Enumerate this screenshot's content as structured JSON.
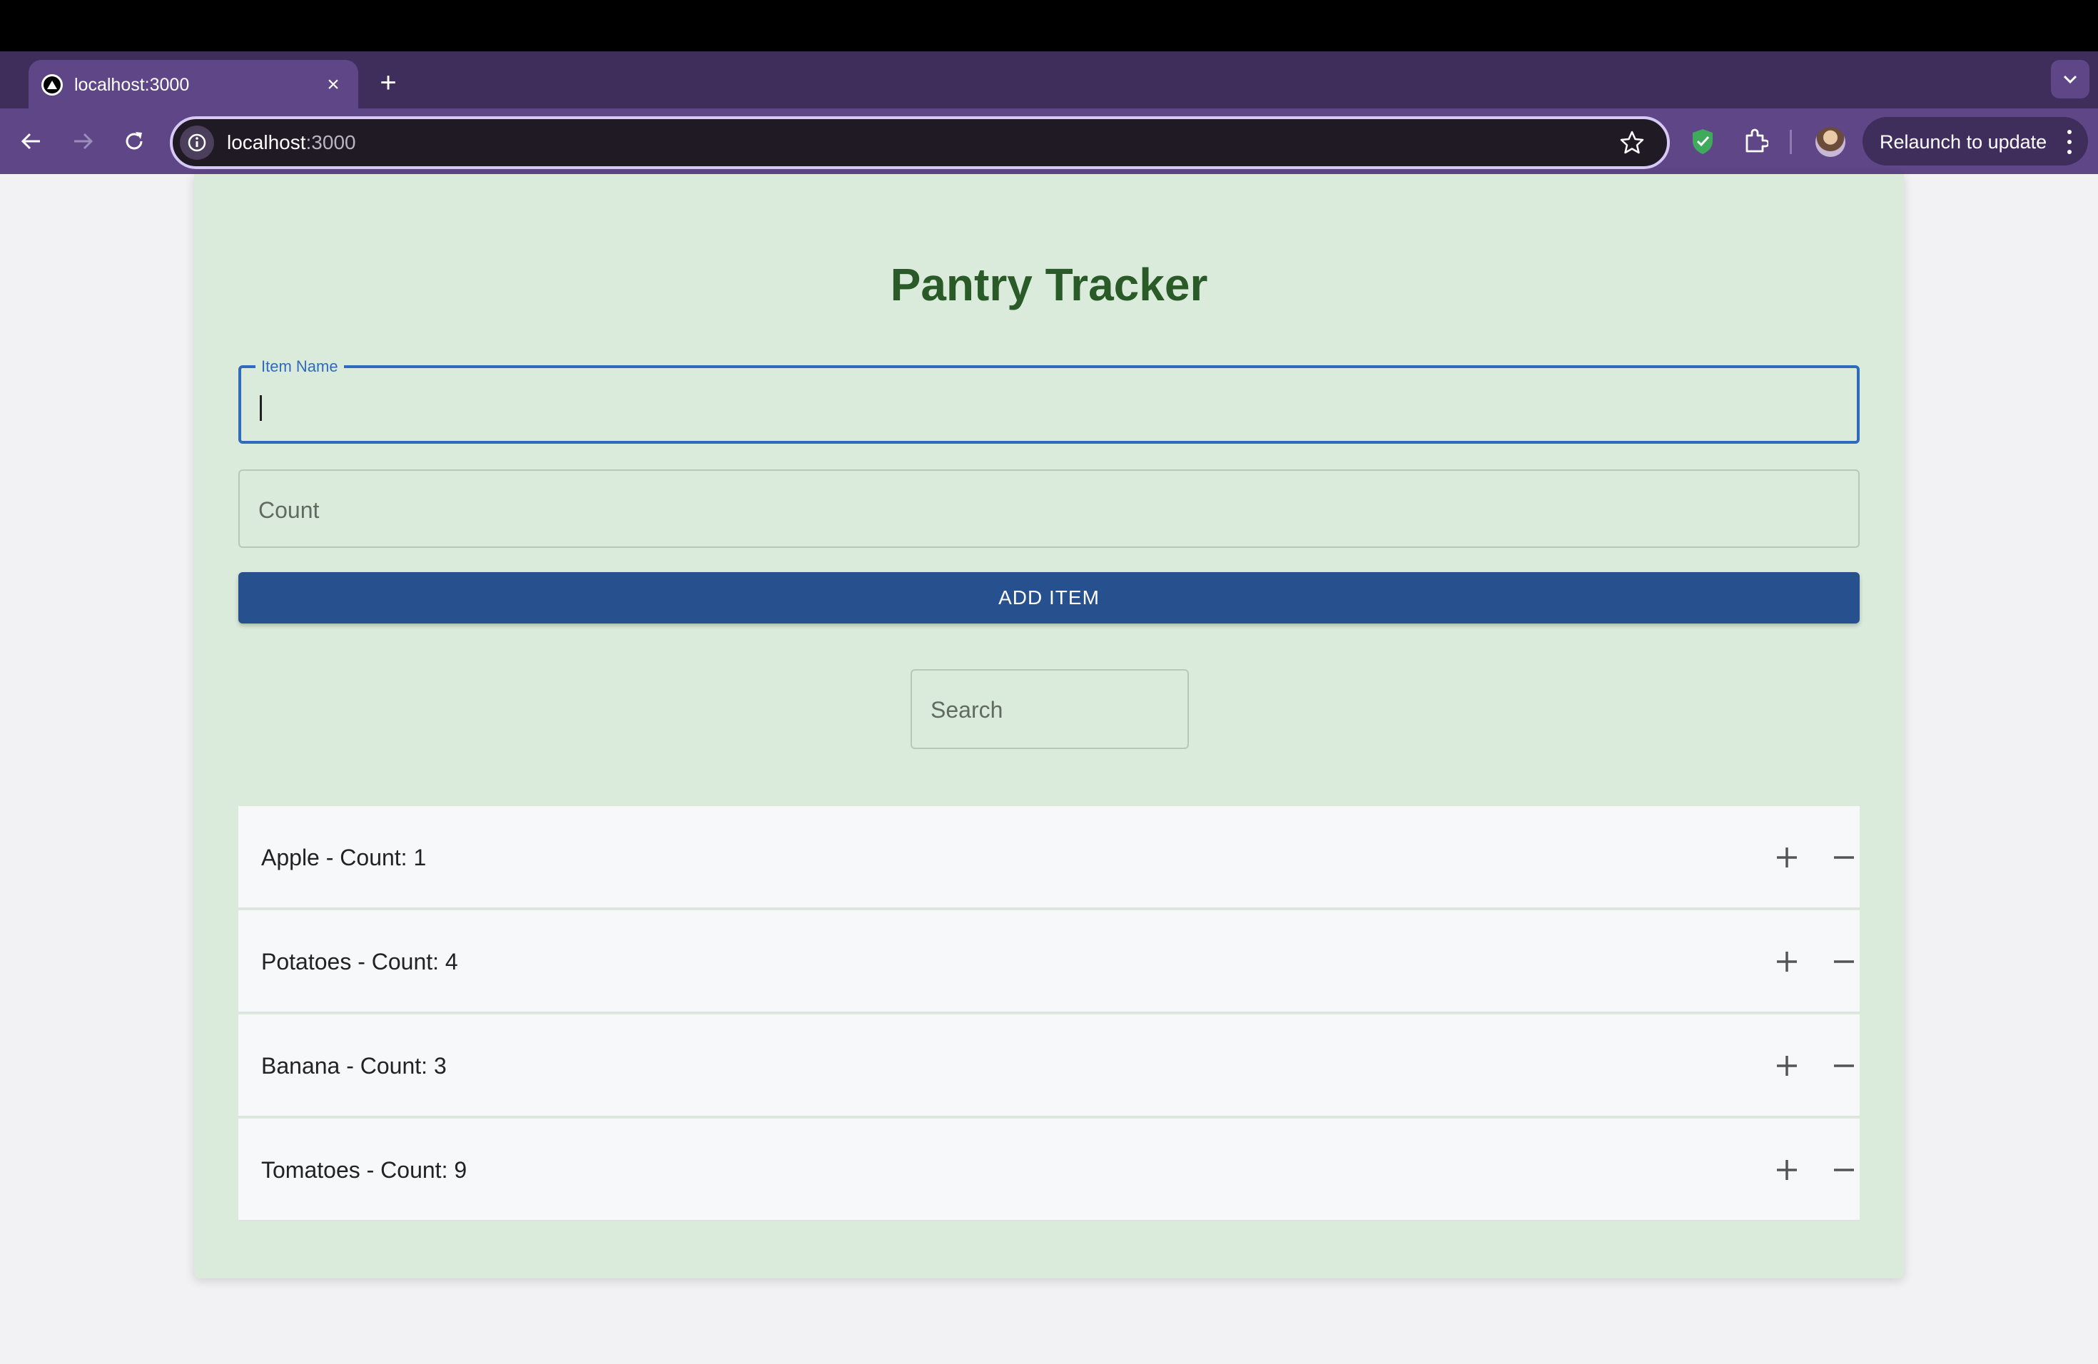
{
  "browser": {
    "tab_title": "localhost:3000",
    "url_host": "localhost",
    "url_port": ":3000",
    "relaunch_label": "Relaunch to update",
    "tab_close_glyph": "×",
    "new_tab_glyph": "+"
  },
  "icons": {
    "favicon": "triangle-icon",
    "back": "arrow-left-icon",
    "forward": "arrow-right-icon",
    "reload": "reload-icon",
    "site_info": "info-icon",
    "bookmark": "star-icon",
    "extension_shield": "shield-check-icon",
    "extensions": "puzzle-icon",
    "menu": "kebab-icon",
    "tab_search": "chevron-down-icon",
    "increment": "plus-icon",
    "decrement": "minus-icon"
  },
  "colors": {
    "title_green": "#2a5a27",
    "card_bg": "#daebdb",
    "button_blue": "#27508f",
    "focus_blue": "#2f6bbd",
    "chrome_purple": "#5e4687"
  },
  "app": {
    "title": "Pantry Tracker",
    "item_name_label": "Item Name",
    "item_name_value": "",
    "count_placeholder": "Count",
    "add_button_label": "ADD ITEM",
    "search_placeholder": "Search",
    "items": [
      {
        "label": "Apple - Count: 1"
      },
      {
        "label": "Potatoes - Count: 4"
      },
      {
        "label": "Banana - Count: 3"
      },
      {
        "label": "Tomatoes - Count: 9"
      }
    ]
  }
}
